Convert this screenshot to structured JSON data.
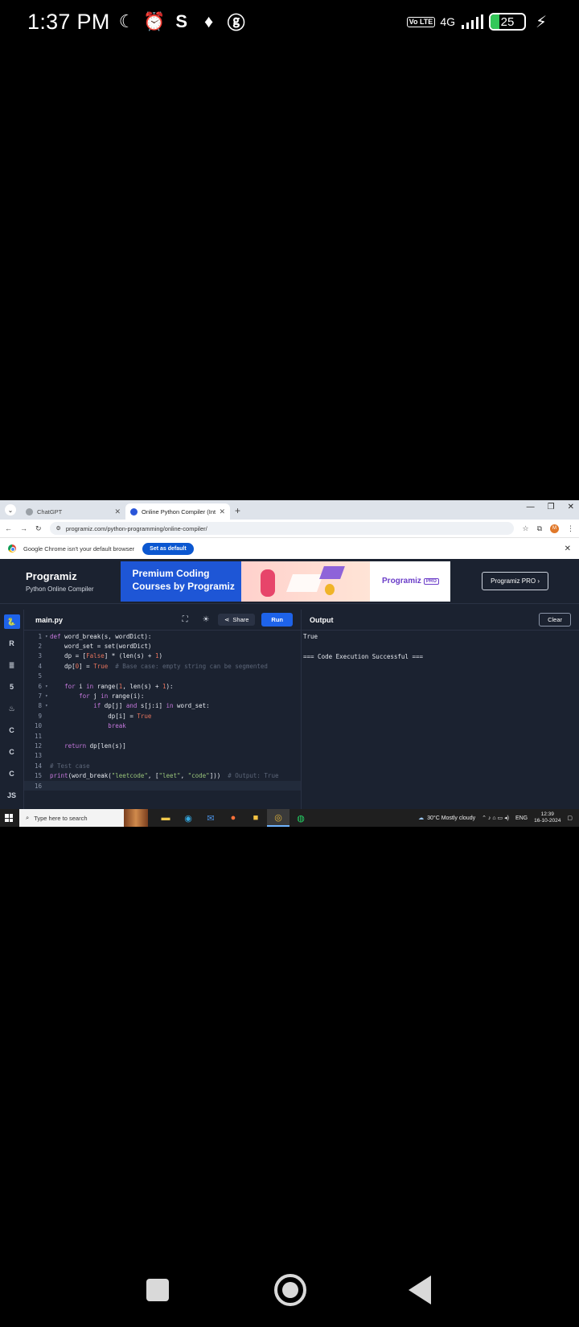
{
  "status_bar": {
    "time": "1:37 PM",
    "network": "4G",
    "volte": "Vo LTE",
    "battery": "25",
    "battery_percent": 25,
    "icons": [
      "moon-icon",
      "alarm-icon",
      "shazam-icon",
      "app-icon",
      "g-icon"
    ]
  },
  "browser": {
    "tabs": [
      {
        "label": "ChatGPT",
        "favicon_color": "#9aa0a6",
        "active": false
      },
      {
        "label": "Online Python Compiler (Inter...",
        "favicon_color": "#2a56d9",
        "active": true
      }
    ],
    "url": "programiz.com/python-programming/online-compiler/",
    "profile_initial": "M",
    "infobar_text": "Google Chrome isn't your default browser",
    "set_default_label": "Set as default"
  },
  "programiz": {
    "logo": "Programiz",
    "subtitle": "Python Online Compiler",
    "banner_headline_1": "Premium Coding",
    "banner_headline_2": "Courses by Programiz",
    "banner_brand": "Programiz",
    "banner_badge": "PRO",
    "pro_button": "Programiz PRO ›",
    "languages": [
      "Py",
      "R",
      "SQL",
      "5",
      "J",
      "C",
      "C+",
      "C#",
      "JS"
    ],
    "filename": "main.py",
    "share_label": "Share",
    "run_label": "Run",
    "output_title": "Output",
    "clear_label": "Clear",
    "output_lines": [
      "True",
      "",
      "=== Code Execution Successful ==="
    ]
  },
  "code": {
    "lines": [
      {
        "n": "1",
        "fold": "▾",
        "tokens": [
          {
            "t": "def ",
            "c": "kw"
          },
          {
            "t": "word_break(s, wordDict):",
            "c": "tx"
          }
        ]
      },
      {
        "n": "2",
        "fold": "",
        "tokens": [
          {
            "t": "    word_set = ",
            "c": "tx"
          },
          {
            "t": "set",
            "c": "tx"
          },
          {
            "t": "(wordDict)",
            "c": "tx"
          }
        ]
      },
      {
        "n": "3",
        "fold": "",
        "tokens": [
          {
            "t": "    dp = [",
            "c": "tx"
          },
          {
            "t": "False",
            "c": "num"
          },
          {
            "t": "] * (",
            "c": "tx"
          },
          {
            "t": "len",
            "c": "tx"
          },
          {
            "t": "(s) + ",
            "c": "tx"
          },
          {
            "t": "1",
            "c": "num"
          },
          {
            "t": ")",
            "c": "tx"
          }
        ]
      },
      {
        "n": "4",
        "fold": "",
        "tokens": [
          {
            "t": "    dp[",
            "c": "tx"
          },
          {
            "t": "0",
            "c": "num"
          },
          {
            "t": "] = ",
            "c": "tx"
          },
          {
            "t": "True",
            "c": "num"
          },
          {
            "t": "  # Base case: empty string can be segmented",
            "c": "cm"
          }
        ]
      },
      {
        "n": "5",
        "fold": "",
        "tokens": []
      },
      {
        "n": "6",
        "fold": "▾",
        "tokens": [
          {
            "t": "    ",
            "c": "tx"
          },
          {
            "t": "for",
            "c": "kw"
          },
          {
            "t": " i ",
            "c": "tx"
          },
          {
            "t": "in",
            "c": "kw"
          },
          {
            "t": " range(",
            "c": "tx"
          },
          {
            "t": "1",
            "c": "num"
          },
          {
            "t": ", len(s) + ",
            "c": "tx"
          },
          {
            "t": "1",
            "c": "num"
          },
          {
            "t": "):",
            "c": "tx"
          }
        ]
      },
      {
        "n": "7",
        "fold": "▾",
        "tokens": [
          {
            "t": "        ",
            "c": "tx"
          },
          {
            "t": "for",
            "c": "kw"
          },
          {
            "t": " j ",
            "c": "tx"
          },
          {
            "t": "in",
            "c": "kw"
          },
          {
            "t": " range(i):",
            "c": "tx"
          }
        ]
      },
      {
        "n": "8",
        "fold": "▾",
        "tokens": [
          {
            "t": "            ",
            "c": "tx"
          },
          {
            "t": "if",
            "c": "kw"
          },
          {
            "t": " dp[j] ",
            "c": "tx"
          },
          {
            "t": "and",
            "c": "kw"
          },
          {
            "t": " s[j:i] ",
            "c": "tx"
          },
          {
            "t": "in",
            "c": "kw"
          },
          {
            "t": " word_set:",
            "c": "tx"
          }
        ]
      },
      {
        "n": "9",
        "fold": "",
        "tokens": [
          {
            "t": "                dp[i] = ",
            "c": "tx"
          },
          {
            "t": "True",
            "c": "num"
          }
        ]
      },
      {
        "n": "10",
        "fold": "",
        "tokens": [
          {
            "t": "                ",
            "c": "tx"
          },
          {
            "t": "break",
            "c": "kw"
          }
        ]
      },
      {
        "n": "11",
        "fold": "",
        "tokens": []
      },
      {
        "n": "12",
        "fold": "",
        "tokens": [
          {
            "t": "    ",
            "c": "tx"
          },
          {
            "t": "return",
            "c": "kw"
          },
          {
            "t": " dp[len(s)]",
            "c": "tx"
          }
        ]
      },
      {
        "n": "13",
        "fold": "",
        "tokens": []
      },
      {
        "n": "14",
        "fold": "",
        "tokens": [
          {
            "t": "# Test case",
            "c": "cm"
          }
        ]
      },
      {
        "n": "15",
        "fold": "",
        "tokens": [
          {
            "t": "print",
            "c": "kw"
          },
          {
            "t": "(word_break(",
            "c": "tx"
          },
          {
            "t": "\"leetcode\"",
            "c": "str"
          },
          {
            "t": ", [",
            "c": "tx"
          },
          {
            "t": "\"leet\"",
            "c": "str"
          },
          {
            "t": ", ",
            "c": "tx"
          },
          {
            "t": "\"code\"",
            "c": "str"
          },
          {
            "t": "]))  ",
            "c": "tx"
          },
          {
            "t": "# Output: True",
            "c": "cm"
          }
        ]
      },
      {
        "n": "16",
        "fold": "",
        "tokens": [],
        "current": true
      }
    ]
  },
  "taskbar": {
    "search_placeholder": "Type here to search",
    "weather": "30°C  Mostly cloudy",
    "lang": "ENG",
    "time": "12:39",
    "date": "16-10-2024",
    "apps": [
      {
        "name": "file-explorer-icon",
        "glyph": "▬",
        "color": "#f2c94c"
      },
      {
        "name": "edge-icon",
        "glyph": "◉",
        "color": "#35a8e0"
      },
      {
        "name": "mail-icon",
        "glyph": "✉",
        "color": "#4a90e2"
      },
      {
        "name": "firefox-icon",
        "glyph": "●",
        "color": "#ff7139"
      },
      {
        "name": "store-icon",
        "glyph": "■",
        "color": "#f5c342"
      },
      {
        "name": "chrome-icon",
        "glyph": "◎",
        "color": "#e0b33a"
      },
      {
        "name": "whatsapp-icon",
        "glyph": "◍",
        "color": "#25d366"
      }
    ]
  }
}
